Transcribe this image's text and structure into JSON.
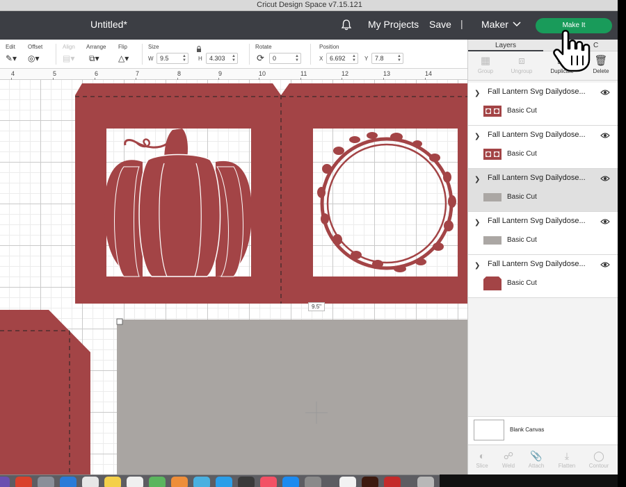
{
  "window": {
    "title": "Cricut Design Space  v7.15.121"
  },
  "header": {
    "doc_title": "Untitled*",
    "my_projects": "My Projects",
    "save": "Save",
    "separator": "|",
    "machine": "Maker",
    "make_it": "Make It"
  },
  "toolbar": {
    "edit": "Edit",
    "offset": "Offset",
    "align": "Align",
    "arrange": "Arrange",
    "flip": "Flip",
    "size": "Size",
    "w_label": "W",
    "w_value": "9.5",
    "h_label": "H",
    "h_value": "4.303",
    "rotate": "Rotate",
    "rotate_value": "0",
    "position": "Position",
    "x_label": "X",
    "x_value": "6.692",
    "y_label": "Y",
    "y_value": "7.8"
  },
  "ruler": {
    "ticks": [
      "4",
      "5",
      "6",
      "7",
      "8",
      "9",
      "10",
      "11",
      "12",
      "13",
      "14"
    ]
  },
  "canvas": {
    "size_tag": "9.5\""
  },
  "layers_panel": {
    "tab_layers": "Layers",
    "tab_other": "C",
    "actions": {
      "group": "Group",
      "ungroup": "Ungroup",
      "duplicate": "Duplicate",
      "delete": "Delete"
    },
    "layers": [
      {
        "name": "Fall Lantern Svg Dailydose...",
        "cut": "Basic Cut",
        "thumb": "pattern",
        "selected": false
      },
      {
        "name": "Fall Lantern Svg Dailydose...",
        "cut": "Basic Cut",
        "thumb": "pattern",
        "selected": false
      },
      {
        "name": "Fall Lantern Svg Dailydose...",
        "cut": "Basic Cut",
        "thumb": "gray",
        "selected": true
      },
      {
        "name": "Fall Lantern Svg Dailydose...",
        "cut": "Basic Cut",
        "thumb": "gray",
        "selected": false
      },
      {
        "name": "Fall Lantern Svg Dailydose...",
        "cut": "Basic Cut",
        "thumb": "red",
        "selected": false
      }
    ],
    "blank_canvas": "Blank Canvas",
    "bottom_actions": {
      "slice": "Slice",
      "weld": "Weld",
      "attach": "Attach",
      "flatten": "Flatten",
      "contour": "Contour"
    }
  },
  "colors": {
    "header_bg": "#3c3e44",
    "make_it_green": "#199b5a",
    "material_red": "#a34446",
    "material_gray": "#a9a5a2"
  }
}
